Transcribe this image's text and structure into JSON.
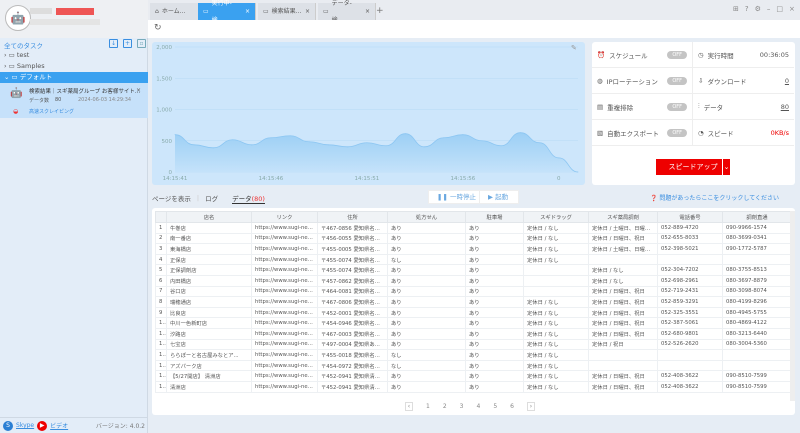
{
  "sidebar": {
    "all_tasks": "全てのタスク",
    "folders": [
      {
        "label": "test"
      },
      {
        "label": "Samples"
      },
      {
        "label": "デフォルト"
      }
    ],
    "task": {
      "title": "検索結果｜スギ薬局グループ お客様サイト...",
      "data_label": "データ数",
      "data_count": "80",
      "timestamp": "2024-06-03 14:29:34",
      "mode": "高速スクレイピング"
    },
    "footer": {
      "skype": "Skype",
      "video": "ビデオ",
      "version": "バージョン: 4.0.2"
    }
  },
  "tabs": [
    {
      "label": "ホーム..."
    },
    {
      "label": "実行中-検...",
      "active": true
    },
    {
      "label": "検索結果..."
    },
    {
      "label": "データ-検..."
    }
  ],
  "chart_data": {
    "type": "area",
    "y_ticks": [
      "2,000",
      "1,500",
      "1,000",
      "500",
      "0"
    ],
    "ylim": [
      0,
      2000
    ],
    "x_tick_labels": [
      "14:15:41",
      "14:15:46",
      "14:15:51",
      "14:15:56",
      "0"
    ],
    "values": [
      597,
      435,
      387,
      516,
      435,
      548,
      580,
      484,
      435,
      403,
      468,
      420,
      613,
      403,
      548,
      597,
      500,
      420,
      629,
      468,
      226,
      0
    ],
    "grid": true,
    "color": "#a6d4f7"
  },
  "stats": {
    "schedule": {
      "label": "スケジュール",
      "state": "OFF"
    },
    "run_time": {
      "label": "実行時間",
      "value": "00:36:05"
    },
    "ip_rotation": {
      "label": "IPローテーション",
      "state": "OFF"
    },
    "download": {
      "label": "ダウンロード",
      "value": "0"
    },
    "dedupe": {
      "label": "重複排除",
      "state": "OFF"
    },
    "data": {
      "label": "データ",
      "value": "80"
    },
    "auto_export": {
      "label": "自動エクスポート",
      "state": "OFF"
    },
    "speed": {
      "label": "スピード",
      "value": "0KB/s"
    },
    "speedup": "スピードアップ"
  },
  "subtabs": {
    "page": "ページを表示",
    "log": "ログ",
    "data": "データ",
    "data_count": "(80)"
  },
  "buttons": {
    "pause": "一時停止",
    "start": "起動"
  },
  "help": "問題があったらここをクリックしてください",
  "table": {
    "headers": [
      "",
      "店名",
      "リンク",
      "住所",
      "処方せん",
      "駐車場",
      "スギドラッグ",
      "スギ薬局調剤",
      "電話番号",
      "調剤直通"
    ],
    "rows": [
      [
        "1",
        "牛巻店",
        "https://www.sugi-net.jp/stor...",
        "〒467-0856 愛知県名古屋...",
        "あり",
        "あり",
        "定休日 / なし",
        "定休日 / 土曜日、日曜日、...",
        "052-889-4720",
        "090-9966-1574"
      ],
      [
        "2",
        "南一番店",
        "https://www.sugi-net.jp/stor...",
        "〒456-0055 愛知県名古屋...",
        "あり",
        "あり",
        "定休日 / なし",
        "定休日 / 日曜日、祝日",
        "052-655-8033",
        "080-3699-0341"
      ],
      [
        "3",
        "東海橋店",
        "https://www.sugi-net.jp/stor...",
        "〒455-0005 愛知県名古屋...",
        "あり",
        "あり",
        "定休日 / なし",
        "定休日 / 土曜日、日曜日、...",
        "052-398-5021",
        "090-1772-5787"
      ],
      [
        "4",
        "正保店",
        "https://www.sugi-net.jp/stor...",
        "〒455-0074 愛知県名古屋...",
        "なし",
        "あり",
        "定休日 / なし",
        "",
        "",
        ""
      ],
      [
        "5",
        "正保調剤店",
        "https://www.sugi-net.jp/stor...",
        "〒455-0074 愛知県名古屋...",
        "あり",
        "あり",
        "",
        "定休日 / なし",
        "052-304-7202",
        "080-3755-8513"
      ],
      [
        "6",
        "内田橋店",
        "https://www.sugi-net.jp/stor...",
        "〒457-0862 愛知県名古屋...",
        "あり",
        "あり",
        "",
        "定休日 / なし",
        "052-698-2961",
        "080-3697-8879"
      ],
      [
        "7",
        "谷口店",
        "https://www.sugi-net.jp/stor...",
        "〒464-0081 愛知県名古屋...",
        "あり",
        "あり",
        "",
        "定休日 / 日曜日、祝日",
        "052-719-2431",
        "080-3098-8074"
      ],
      [
        "8",
        "瑞穂通店",
        "https://www.sugi-net.jp/stor...",
        "〒467-0806 愛知県名古屋...",
        "あり",
        "あり",
        "定休日 / なし",
        "定休日 / 日曜日、祝日",
        "052-859-3291",
        "080-4199-8296"
      ],
      [
        "9",
        "比良店",
        "https://www.sugi-net.jp/stor...",
        "〒452-0001 愛知県名古屋...",
        "あり",
        "あり",
        "定休日 / なし",
        "定休日 / 日曜日、祝日",
        "052-325-3551",
        "080-4945-5755"
      ],
      [
        "10",
        "中川一色新町店",
        "https://www.sugi-net.jp/stor...",
        "〒454-0946 愛知県名古屋...",
        "あり",
        "あり",
        "定休日 / なし",
        "定休日 / 日曜日、祝日",
        "052-387-5061",
        "080-4869-4122"
      ],
      [
        "11",
        "汐路店",
        "https://www.sugi-net.jp/stor...",
        "〒467-0003 愛知県名古屋...",
        "あり",
        "あり",
        "定休日 / なし",
        "定休日 / 日曜日、祝日",
        "052-680-9801",
        "080-3213-6440"
      ],
      [
        "12",
        "七宝店",
        "https://www.sugi-net.jp/stor...",
        "〒497-0004 愛知県あま市...",
        "あり",
        "あり",
        "定休日 / なし",
        "定休日 / 祝日",
        "052-526-2620",
        "080-3004-5360"
      ],
      [
        "13",
        "ららぽーと名古屋みなとア...",
        "https://www.sugi-net.jp/stor...",
        "〒455-0018 愛知県名古屋...",
        "なし",
        "あり",
        "定休日 / なし",
        "",
        "",
        ""
      ],
      [
        "14",
        "アズパーク店",
        "https://www.sugi-net.jp/stor...",
        "〒454-0972 愛知県名古屋...",
        "なし",
        "あり",
        "定休日 / なし",
        "",
        "",
        ""
      ],
      [
        "15",
        "【5/27開店】 清洲店",
        "https://www.sugi-net.jp/stor...",
        "〒452-0941 愛知県清須市...",
        "あり",
        "あり",
        "定休日 / なし",
        "定休日 / 日曜日、祝日",
        "052-408-3622",
        "090-8510-7599"
      ],
      [
        "16",
        "清洲店",
        "https://www.sugi-net.jp/stor...",
        "〒452-0941 愛知県清須市...",
        "あり",
        "あり",
        "定休日 / なし",
        "定休日 / 日曜日、祝日",
        "052-408-3622",
        "090-8510-7599"
      ]
    ]
  },
  "pagination": {
    "pages": [
      "1",
      "2",
      "3",
      "4",
      "5",
      "6"
    ]
  },
  "colors": {
    "accent": "#3aa1f0",
    "speedup": "#e00000",
    "speed_value": "#e00000"
  }
}
